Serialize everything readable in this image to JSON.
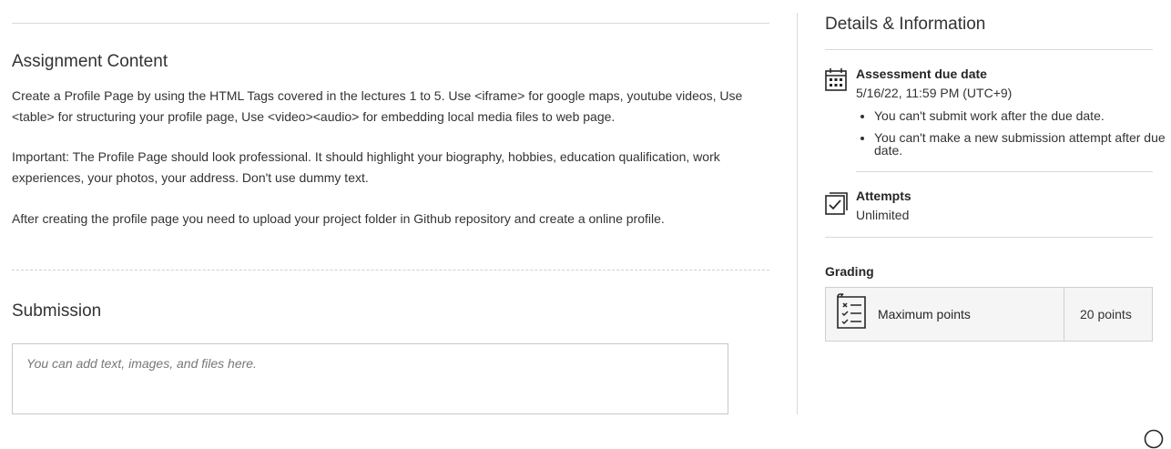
{
  "assignment": {
    "title": "Assignment Content",
    "paragraphs": [
      "Create a Profile Page by using the HTML Tags covered in the lectures 1 to 5. Use  <iframe> for google maps, youtube videos, Use <table> for structuring your profile page, Use <video><audio> for embedding local media files to web page.",
      "Important: The Profile Page should look professional. It should highlight your biography, hobbies, education qualification, work experiences, your photos, your address. Don't use dummy text.",
      "After creating the profile page you need to upload your project folder in Github repository and create a online profile."
    ]
  },
  "submission": {
    "title": "Submission",
    "placeholder": "You can add text, images, and files here."
  },
  "details": {
    "title": "Details & Information",
    "due": {
      "icon": "calendar-icon",
      "label": "Assessment due date",
      "value": "5/16/22, 11:59 PM (UTC+9)",
      "notes": [
        "You can't submit work after the due date.",
        "You can't make a new submission attempt after due date."
      ]
    },
    "attempts": {
      "icon": "checkbox-icon",
      "label": "Attempts",
      "value": "Unlimited"
    },
    "grading": {
      "label": "Grading",
      "icon": "rubric-checklist-icon",
      "max_label": "Maximum points",
      "max_value": "20 points"
    }
  }
}
